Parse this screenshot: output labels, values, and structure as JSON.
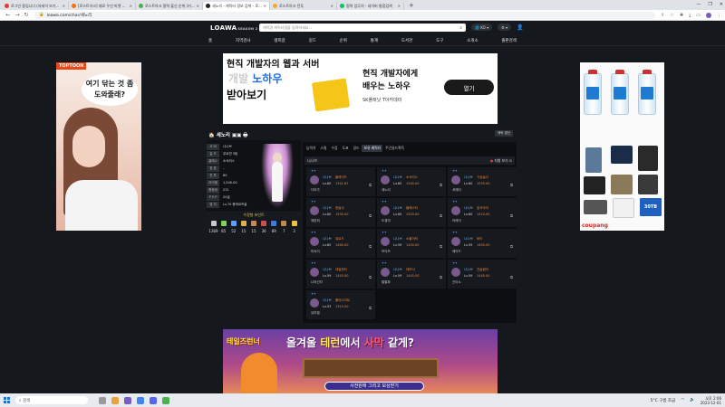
{
  "browser": {
    "tabs": [
      {
        "label": "로그인 중입니다 (자세히 보기...",
        "color": "#e53935"
      },
      {
        "label": "[로스트아크] 재료 우선 마켓 ...",
        "color": "#ff6d00"
      },
      {
        "label": "로스트아크 협력 출신 순위 (키...",
        "color": "#4caf50"
      },
      {
        "label": "세노리 - 캐릭터 정보 검색 - 로...",
        "color": "#222222"
      },
      {
        "label": "로스트아크 전투",
        "color": "#f9a825"
      },
      {
        "label": "협력 업무의 - 네이버 통합검색",
        "color": "#03c75a"
      }
    ],
    "new_tab": "+",
    "url": "loawa.com/char/세노리",
    "window_controls": [
      "—",
      "❐",
      "✕"
    ]
  },
  "site": {
    "logo": "LOAWA",
    "logo_sub": "SEASON 2",
    "search_placeholder": "캐릭명 캐릭터명을 입력하세요...",
    "lang": "KO",
    "menu": [
      "홈",
      "지역검사",
      "랭피갈",
      "길드",
      "순위",
      "통계",
      "도서관",
      "도구",
      "소개소",
      "출판검색"
    ]
  },
  "ads": {
    "left_brand": "TOPTOON",
    "left_bubble": "여기 닦는 것 좀 도와줄래?",
    "top_line1": "현직 개발자의 웹과 서버",
    "top_line2_a": "개발 ",
    "top_line2_b": "노하우",
    "top_line3": "받아보기",
    "top_right1": "현직 개발자에게",
    "top_right2": "배우는 노하우",
    "top_right_small": "SK플래닛 T아카데미",
    "top_button": "열기",
    "right_brand": "coupang",
    "right_tag": "30TB",
    "bottom_logo": "테일즈런너",
    "bottom_title_a": "올겨울 ",
    "bottom_title_b": "테런",
    "bottom_title_c": "에서 ",
    "bottom_title_d": "사막",
    "bottom_title_e": " 같게?",
    "bottom_cta": "사전원에 그리고 보상받기"
  },
  "profile": {
    "name": "세노리",
    "renew": "캐릭 갱신",
    "info": [
      {
        "k": "서 버",
        "v": "니나브"
      },
      {
        "k": "길 드",
        "v": "무르연 3팀"
      },
      {
        "k": "클래스",
        "v": "소서리스"
      },
      {
        "k": "칭 호",
        "v": "-"
      },
      {
        "k": "전 투",
        "v": "60"
      },
      {
        "k": "아이템",
        "v": "1,540.00"
      },
      {
        "k": "원정대",
        "v": "231"
      },
      {
        "k": "P V P",
        "v": "20급"
      },
      {
        "k": "영 지",
        "v": "Lv.70 몽마르뜨골"
      }
    ],
    "gem_button": "수정형 포인트",
    "stats": [
      {
        "n": "1369",
        "color": "#c9c9c9"
      },
      {
        "n": "85",
        "color": "#7fd35a"
      },
      {
        "n": "52",
        "color": "#5aa0ff"
      },
      {
        "n": "15",
        "color": "#e0b24a"
      },
      {
        "n": "15",
        "color": "#c58b4c"
      },
      {
        "n": "36",
        "color": "#d04d4d"
      },
      {
        "n": "89",
        "color": "#3d7be0"
      },
      {
        "n": "7",
        "color": "#c08a4a"
      },
      {
        "n": "3",
        "color": "#f0c040"
      }
    ]
  },
  "panel": {
    "tabs": [
      "능력치",
      "스킬",
      "수집",
      "도표",
      "길드",
      "보유 캐릭터",
      "주간골드획득"
    ],
    "active_tab": 5,
    "subhead_left": "니나브",
    "subhead_right": "지형 보기",
    "characters": [
      {
        "cls": "니나브",
        "title": "블레이드",
        "lv": "Lv.60",
        "il": "1341.67",
        "nm": "다리가"
      },
      {
        "cls": "니나브",
        "title": "소서리스",
        "lv": "Lv.60",
        "il": "1540.00",
        "nm": "세노리"
      },
      {
        "cls": "니나브",
        "title": "기상술사",
        "lv": "Lv.60",
        "il": "1535.00",
        "nm": "셔레티"
      },
      {
        "cls": "니나브",
        "title": "창술사",
        "lv": "Lv.60",
        "il": "1530.00",
        "nm": "재련피"
      },
      {
        "cls": "니나브",
        "title": "블래스터",
        "lv": "Lv.60",
        "il": "1520.00",
        "nm": "도경미"
      },
      {
        "cls": "니나브",
        "title": "호크아이",
        "lv": "Lv.60",
        "il": "1510.00",
        "nm": "카레이"
      },
      {
        "cls": "니나브",
        "title": "워로드",
        "lv": "Lv.60",
        "il": "1460.00",
        "nm": "미숙이"
      },
      {
        "cls": "니나브",
        "title": "소울이터",
        "lv": "Lv.59",
        "il": "1450.00",
        "nm": "보이즈"
      },
      {
        "cls": "니나브",
        "title": "바드",
        "lv": "Lv.59",
        "il": "1450.00",
        "nm": "메이드"
      },
      {
        "cls": "니나브",
        "title": "데빌헌터",
        "lv": "Lv.59",
        "il": "1445.00",
        "nm": "나의선자"
      },
      {
        "cls": "니나브",
        "title": "데모닉",
        "lv": "Lv.59",
        "il": "1445.00",
        "nm": "팔팔파"
      },
      {
        "cls": "니나브",
        "title": "건슬링어",
        "lv": "Lv.59",
        "il": "1445.00",
        "nm": "건이노"
      },
      {
        "cls": "니나브",
        "title": "홀리나이트",
        "lv": "Lv.53",
        "il": "1315.00",
        "nm": "유미엘"
      }
    ]
  },
  "taskbar": {
    "search": "검색",
    "weather": "5°C 구름 조금",
    "time": "오후 2:06",
    "date": "2023-12-01"
  }
}
